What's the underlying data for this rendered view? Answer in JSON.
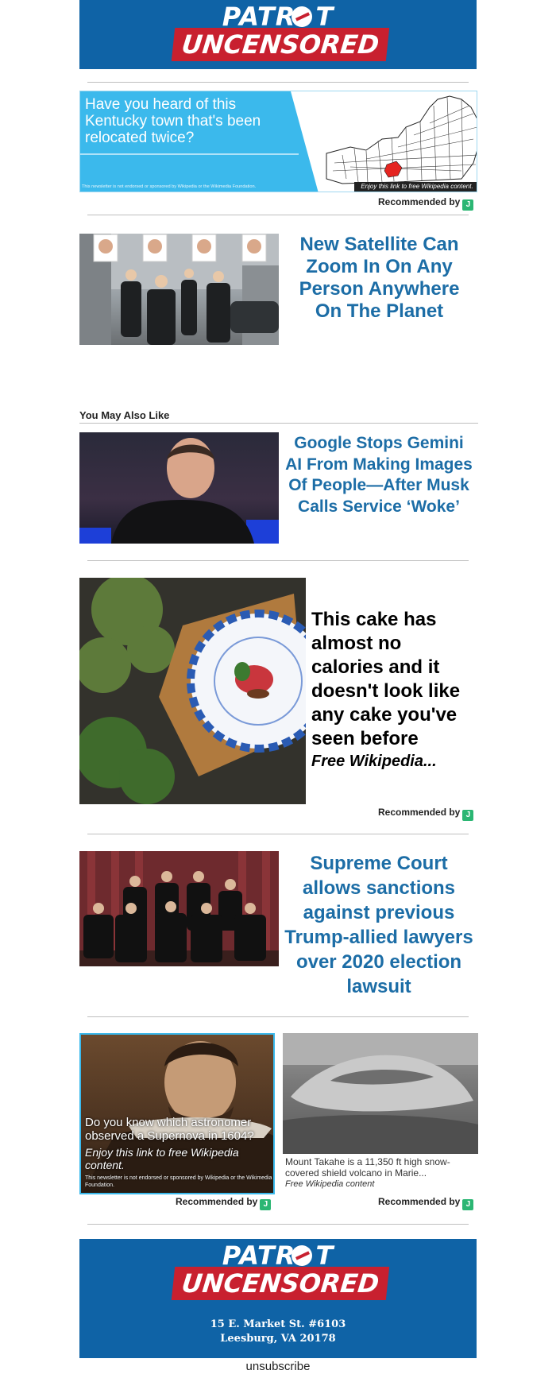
{
  "header": {
    "logo_top": "PATRI   T",
    "logo_bottom": "UNCENSORED"
  },
  "ad_kentucky": {
    "headline": "Have you heard of this Kentucky town that's been relocated twice?",
    "disclaimer": "This newsletter is not endorsed or sponsored by Wikipedia or the Wikimedia Foundation.",
    "map_caption": "Enjoy this link to free Wikipedia content.",
    "recommended_label": "Recommended by",
    "colors": {
      "panel": "#3bb9ec",
      "map_highlight": "#e52521"
    }
  },
  "article_satellite": {
    "title": "New Satellite Can Zoom In On Any Person Anywhere On The Planet",
    "image_icon": "business-people-photo"
  },
  "section_heading": "You May Also Like",
  "article_gemini": {
    "title": "Google Stops Gemini AI From Making Images Of People—After Musk Calls Service ‘Woke’",
    "image_icon": "elon-musk-photo"
  },
  "ad_cake": {
    "headline": "This cake has almost no calories and it doesn't look like any cake you've seen before",
    "source": "Free Wikipedia...",
    "recommended_label": "Recommended by",
    "image_icon": "cake-plate-photo"
  },
  "article_court": {
    "title": "Supreme Court allows sanctions against previous Trump-allied lawyers over 2020 election lawsuit",
    "image_icon": "supreme-court-justices-photo"
  },
  "ad_astronomer": {
    "headline": "Do you know which astronomer observed a Supernova in 1604?",
    "subline": "Enjoy this link to free Wikipedia content.",
    "disclaimer": "This newsletter is not endorsed or sponsored by Wikipedia or the Wikimedia Foundation.",
    "recommended_label": "Recommended by"
  },
  "ad_takahe": {
    "description": "Mount Takahe is a 11,350 ft high snow-covered shield volcano in Marie...",
    "source": "Free Wikipedia content",
    "recommended_label": "Recommended by"
  },
  "footer": {
    "logo_top": "PATRI   T",
    "logo_bottom": "UNCENSORED",
    "address_line1": "15 E. Market St. #6103",
    "address_line2": "Leesburg, VA 20178",
    "unsubscribe": "unsubscribe",
    "colors": {
      "brand_blue": "#0f63a6",
      "brand_red": "#c8202f"
    }
  }
}
